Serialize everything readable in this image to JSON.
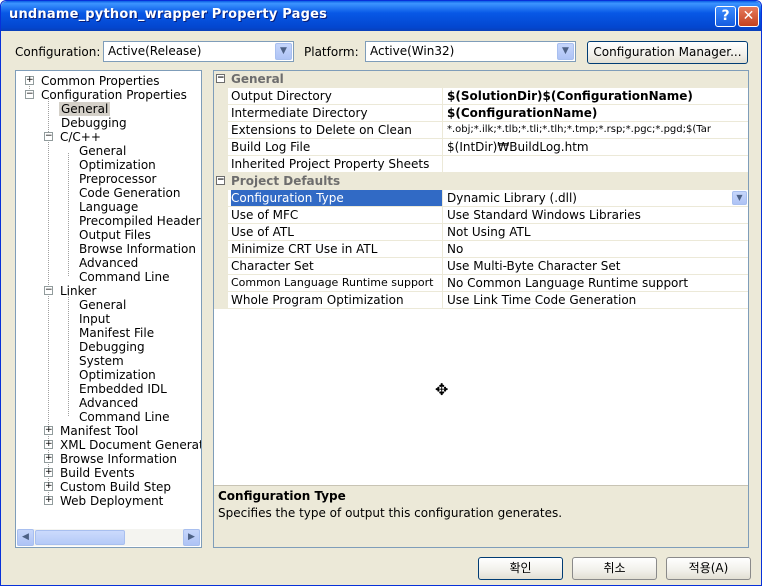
{
  "window": {
    "title": "undname_python_wrapper Property Pages"
  },
  "titlebar": {
    "help_label": "?",
    "close_label": "✕"
  },
  "top": {
    "configuration_label": "Configuration:",
    "configuration_value": "Active(Release)",
    "platform_label": "Platform:",
    "platform_value": "Active(Win32)",
    "config_manager_label": "Configuration Manager..."
  },
  "tree": {
    "items": [
      {
        "label": "Common Properties",
        "expander": "+"
      },
      {
        "label": "Configuration Properties",
        "expander": "−"
      },
      {
        "label": "General"
      },
      {
        "label": "Debugging"
      },
      {
        "label": "C/C++",
        "expander": "−"
      },
      {
        "label": "General"
      },
      {
        "label": "Optimization"
      },
      {
        "label": "Preprocessor"
      },
      {
        "label": "Code Generation"
      },
      {
        "label": "Language"
      },
      {
        "label": "Precompiled Headers"
      },
      {
        "label": "Output Files"
      },
      {
        "label": "Browse Information"
      },
      {
        "label": "Advanced"
      },
      {
        "label": "Command Line"
      },
      {
        "label": "Linker",
        "expander": "−"
      },
      {
        "label": "General"
      },
      {
        "label": "Input"
      },
      {
        "label": "Manifest File"
      },
      {
        "label": "Debugging"
      },
      {
        "label": "System"
      },
      {
        "label": "Optimization"
      },
      {
        "label": "Embedded IDL"
      },
      {
        "label": "Advanced"
      },
      {
        "label": "Command Line"
      },
      {
        "label": "Manifest Tool",
        "expander": "+"
      },
      {
        "label": "XML Document Generator",
        "expander": "+"
      },
      {
        "label": "Browse Information",
        "expander": "+"
      },
      {
        "label": "Build Events",
        "expander": "+"
      },
      {
        "label": "Custom Build Step",
        "expander": "+"
      },
      {
        "label": "Web Deployment",
        "expander": "+"
      }
    ]
  },
  "grid": {
    "categories": [
      {
        "title": "General",
        "expander": "−",
        "rows": [
          {
            "name": "Output Directory",
            "value": "$(SolutionDir)$(ConfigurationName)",
            "bold": true
          },
          {
            "name": "Intermediate Directory",
            "value": "$(ConfigurationName)",
            "bold": true
          },
          {
            "name": "Extensions to Delete on Clean",
            "value": "*.obj;*.ilk;*.tlb;*.tli;*.tlh;*.tmp;*.rsp;*.pgc;*.pgd;$(Tar"
          },
          {
            "name": "Build Log File",
            "value": "$(IntDir)₩BuildLog.htm"
          },
          {
            "name": "Inherited Project Property Sheets",
            "value": ""
          }
        ]
      },
      {
        "title": "Project Defaults",
        "expander": "−",
        "rows": [
          {
            "name": "Configuration Type",
            "value": "Dynamic Library (.dll)",
            "selected": true
          },
          {
            "name": "Use of MFC",
            "value": "Use Standard Windows Libraries"
          },
          {
            "name": "Use of ATL",
            "value": "Not Using ATL"
          },
          {
            "name": "Minimize CRT Use in ATL",
            "value": "No"
          },
          {
            "name": "Character Set",
            "value": "Use Multi-Byte Character Set"
          },
          {
            "name": "Common Language Runtime support",
            "value": "No Common Language Runtime support"
          },
          {
            "name": "Whole Program Optimization",
            "value": "Use Link Time Code Generation"
          }
        ]
      }
    ]
  },
  "description": {
    "title": "Configuration Type",
    "text": "Specifies the type of output this configuration generates."
  },
  "buttons": {
    "ok": "확인",
    "cancel": "취소",
    "apply": "적용(A)"
  },
  "colors": {
    "title_bar": "#0858e6",
    "selection": "#316ac5",
    "panel": "#ece9d8"
  },
  "cursor_glyph": "✥"
}
